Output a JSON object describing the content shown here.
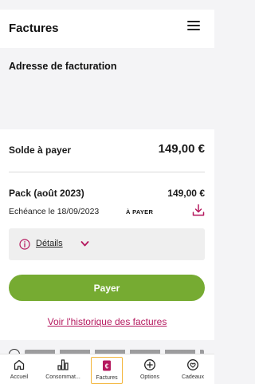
{
  "header": {
    "title": "Factures"
  },
  "address": {
    "title": "Adresse de facturation"
  },
  "balance": {
    "label": "Solde à payer",
    "amount": "149,00 €"
  },
  "invoice": {
    "title": "Pack (août 2023)",
    "amount": "149,00 €",
    "due_date": "Echéance le 18/09/2023",
    "status": "À PAYER",
    "details_label": "Détails"
  },
  "actions": {
    "pay_label": "Payer",
    "history_label": "Voir l'historique des factures"
  },
  "tabs": [
    {
      "label": "Accueil"
    },
    {
      "label": "Consommat..."
    },
    {
      "label": "Factures"
    },
    {
      "label": "Options"
    },
    {
      "label": "Cadeaux"
    }
  ],
  "colors": {
    "accent": "#b5195f",
    "pay_button": "#76ab32",
    "active_tab_border": "#f3b53a"
  },
  "icons": [
    "menu-icon",
    "download-icon",
    "info-icon",
    "chevron-down-icon",
    "home-icon",
    "chart-icon",
    "euro-invoice-icon",
    "plus-circle-icon",
    "gift-icon"
  ]
}
